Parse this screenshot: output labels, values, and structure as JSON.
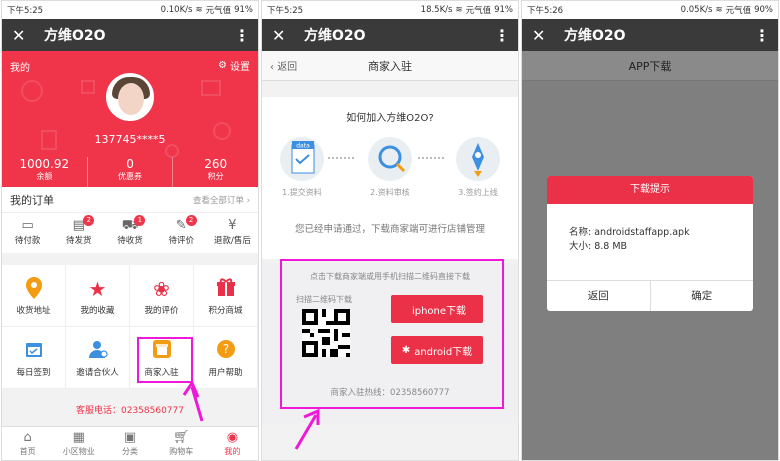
{
  "panel1": {
    "status": {
      "time": "下午5:25",
      "net": "0.10K/s",
      "carrier": "元气值",
      "battery": "91%"
    },
    "app_title": "方维O2O",
    "hero": {
      "mine": "我的",
      "settings": "设置",
      "phone": "137745****5"
    },
    "stats": [
      {
        "value": "1000.92",
        "label": "余额"
      },
      {
        "value": "0",
        "label": "优惠券"
      },
      {
        "value": "260",
        "label": "积分"
      }
    ],
    "orders_title": "我的订单",
    "orders_all": "查看全部订单",
    "orders": [
      {
        "label": "待付款",
        "badge": "",
        "icon": "wallet-icon"
      },
      {
        "label": "待发货",
        "badge": "2",
        "icon": "box-icon"
      },
      {
        "label": "待收货",
        "badge": "1",
        "icon": "truck-icon"
      },
      {
        "label": "待评价",
        "badge": "2",
        "icon": "comment-icon"
      },
      {
        "label": "退款/售后",
        "badge": "",
        "icon": "refund-icon"
      }
    ],
    "grid": [
      {
        "label": "收货地址",
        "icon": "location-icon",
        "color": "#f39c12"
      },
      {
        "label": "我的收藏",
        "icon": "star-icon",
        "color": "#ea3148"
      },
      {
        "label": "我的评价",
        "icon": "flower-icon",
        "color": "#ea3148"
      },
      {
        "label": "积分商城",
        "icon": "gift-icon",
        "color": "#ea3148"
      },
      {
        "label": "每日签到",
        "icon": "calendar-icon",
        "color": "#3d8fe0"
      },
      {
        "label": "邀请合伙人",
        "icon": "user-plus-icon",
        "color": "#3d8fe0"
      },
      {
        "label": "商家入驻",
        "icon": "shop-icon",
        "color": "#f39c12"
      },
      {
        "label": "用户帮助",
        "icon": "help-icon",
        "color": "#f39c12"
      }
    ],
    "hotline": "客服电话：02358560777",
    "tabs": [
      {
        "label": "首页",
        "icon": "home-icon"
      },
      {
        "label": "小区物业",
        "icon": "building-icon"
      },
      {
        "label": "分类",
        "icon": "category-icon"
      },
      {
        "label": "购物车",
        "icon": "cart-icon"
      },
      {
        "label": "我的",
        "icon": "user-icon"
      }
    ]
  },
  "panel2": {
    "status": {
      "time": "下午5:25",
      "net": "18.5K/s",
      "carrier": "元气值",
      "battery": "91%"
    },
    "app_title": "方维O2O",
    "back": "返回",
    "nav_title": "商家入驻",
    "question": "如何加入方维O2O?",
    "doc_tag": "data",
    "steps": [
      "1.提交资料",
      "2.资料审核",
      "3.签约上线"
    ],
    "message": "您已经申请通过，下载商家端可进行店铺管理",
    "download_hint": "点击下载商家端或用手机扫描二维码直接下载",
    "scan_label": "扫描二维码下载",
    "iphone_btn": "iphone下载",
    "android_btn": "android下载",
    "hotline": "商家入驻热线：02358560777"
  },
  "panel3": {
    "status": {
      "time": "下午5:26",
      "net": "0.05K/s",
      "carrier": "元气值",
      "battery": "90%"
    },
    "app_title": "方维O2O",
    "nav_title": "APP下载",
    "dialog_title": "下载提示",
    "file_name": "名称: androidstaffapp.apk",
    "file_size": "大小: 8.8 MB",
    "back_btn": "返回",
    "ok_btn": "确定"
  },
  "colors": {
    "accent": "#ea3148",
    "highlight": "#f018d8",
    "topbar": "#3a3a3a"
  }
}
